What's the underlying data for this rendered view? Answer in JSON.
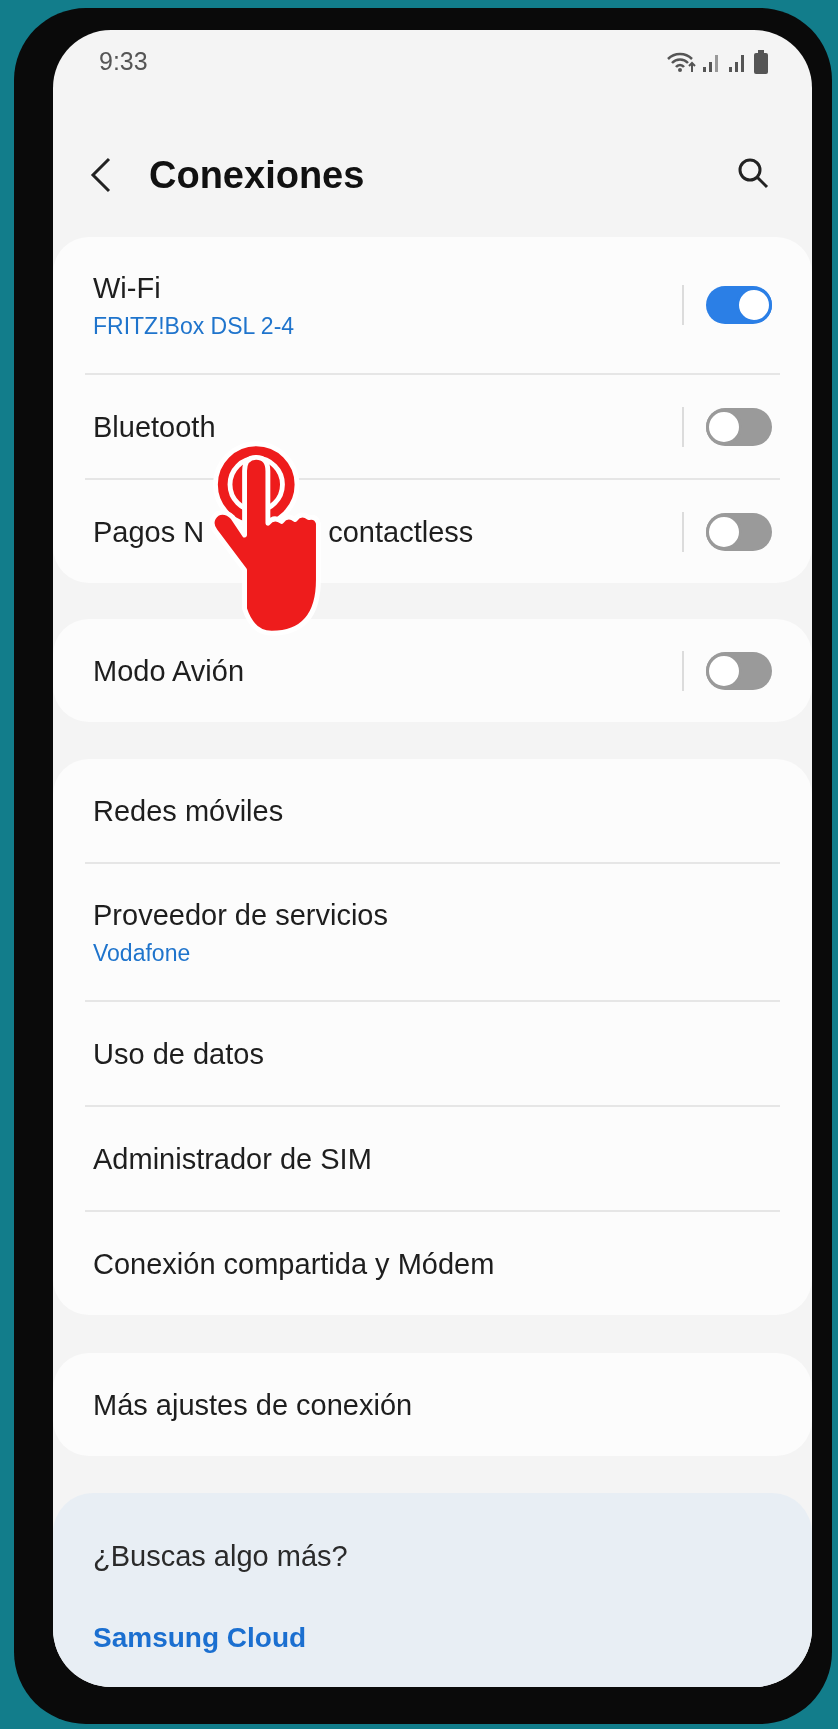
{
  "status_bar": {
    "time": "9:33"
  },
  "header": {
    "title": "Conexiones"
  },
  "groups": [
    {
      "items": [
        {
          "kind": "toggle",
          "title": "Wi-Fi",
          "subtitle": "FRITZ!Box DSL 2-4",
          "on": true
        },
        {
          "kind": "toggle",
          "title": "Bluetooth",
          "on": false
        },
        {
          "kind": "toggle",
          "title": "Pagos N",
          "title_after_overlay": "contactless",
          "on": false
        }
      ]
    },
    {
      "items": [
        {
          "kind": "toggle",
          "title": "Modo Avión",
          "on": false
        }
      ]
    },
    {
      "items": [
        {
          "kind": "link",
          "title": "Redes móviles"
        },
        {
          "kind": "link",
          "title": "Proveedor de servicios",
          "subtitle": "Vodafone"
        },
        {
          "kind": "link",
          "title": "Uso de datos"
        },
        {
          "kind": "link",
          "title": "Administrador de SIM"
        },
        {
          "kind": "link",
          "title": "Conexión compartida y Módem"
        }
      ]
    },
    {
      "items": [
        {
          "kind": "link",
          "title": "Más ajustes de conexión"
        }
      ]
    }
  ],
  "suggestions": {
    "heading": "¿Buscas algo más?",
    "links": [
      "Samsung Cloud"
    ]
  }
}
